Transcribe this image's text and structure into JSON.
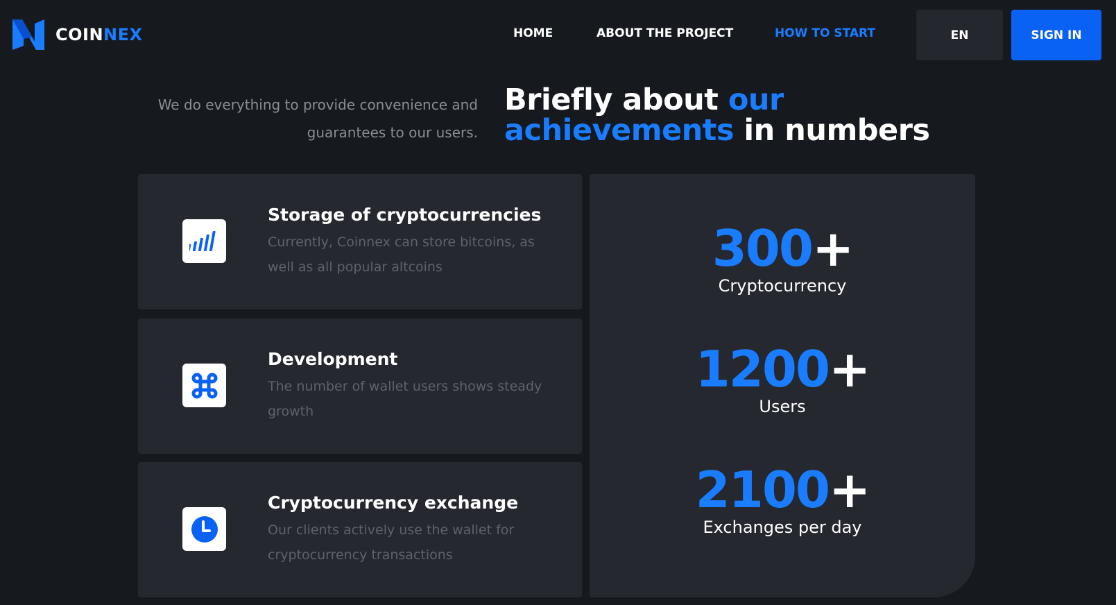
{
  "header": {
    "logo": {
      "part1": "COIN",
      "part2": "NEX",
      "icon": "coinnex-logo-icon"
    },
    "nav": [
      {
        "label": "HOME",
        "active": false
      },
      {
        "label": "ABOUT THE PROJECT",
        "active": false
      },
      {
        "label": "HOW TO START",
        "active": true
      }
    ],
    "lang_label": "EN",
    "signin_label": "SIGN IN"
  },
  "intro": {
    "subtitle": "We do everything to provide convenience and guarantees to our users.",
    "headline": {
      "p1": "Briefly about ",
      "p2": "our achievements",
      "p3": " in numbers"
    }
  },
  "features": [
    {
      "icon": "signal-bars-icon",
      "title": "Storage of cryptocurrencies",
      "description": "Currently, Coinnex can store bitcoins, as well as all popular altcoins"
    },
    {
      "icon": "command-icon",
      "title": "Development",
      "description": "The number of wallet users shows steady growth"
    },
    {
      "icon": "clock-icon",
      "title": "Cryptocurrency exchange",
      "description": "Our clients actively use the wallet for cryptocurrency transactions"
    }
  ],
  "stats": [
    {
      "value": "300",
      "suffix": "+",
      "label": "Cryptocurrency"
    },
    {
      "value": "1200",
      "suffix": "+",
      "label": "Users"
    },
    {
      "value": "2100",
      "suffix": "+",
      "label": "Exchanges per day"
    }
  ],
  "colors": {
    "background": "#161a1f",
    "card": "#25282f",
    "accent": "#1a7cff",
    "button_primary": "#0a62f5"
  }
}
